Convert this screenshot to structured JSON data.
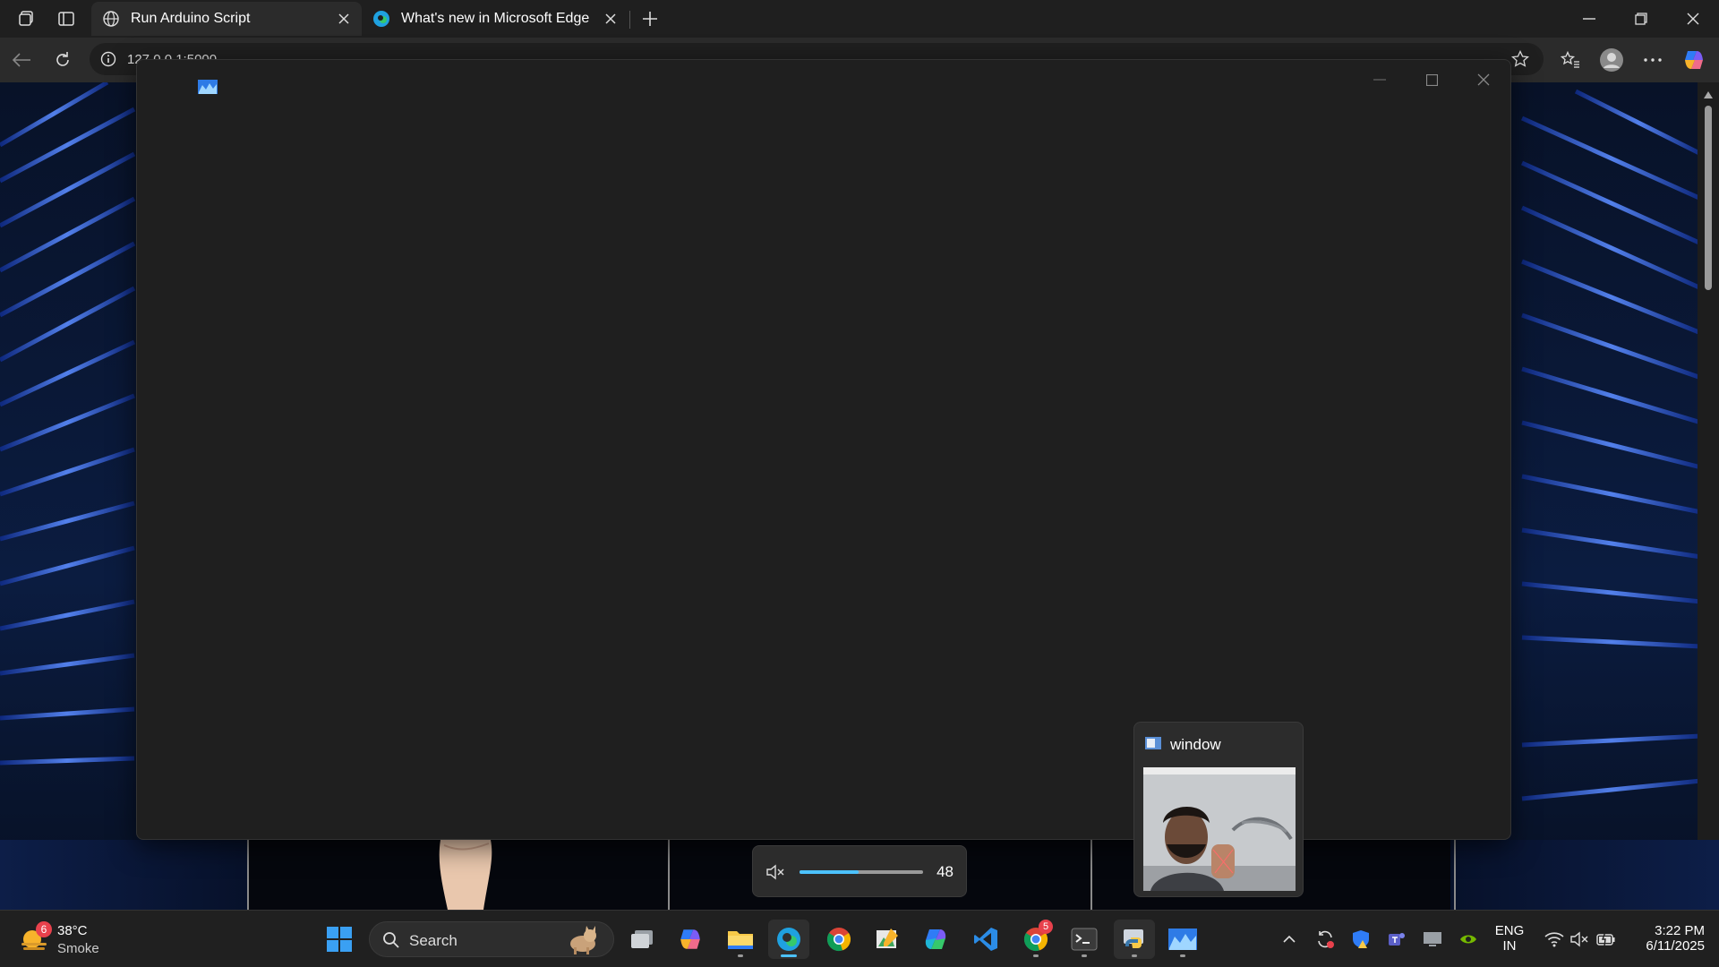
{
  "browser": {
    "tabs": [
      {
        "label": "Run Arduino Script",
        "active": true
      },
      {
        "label": "What's new in Microsoft Edge",
        "active": false
      }
    ],
    "address": "127.0.0.1:5000"
  },
  "volume_flyout": {
    "level": 48,
    "level_label": "48",
    "muted": true
  },
  "thumbnail": {
    "title": "window"
  },
  "taskbar": {
    "weather": {
      "temp": "38°C",
      "condition": "Smoke",
      "badge": "6"
    },
    "search_label": "Search",
    "chrome_badge": "5",
    "language": {
      "line1": "ENG",
      "line2": "IN"
    },
    "clock": {
      "time": "3:22 PM",
      "date": "6/11/2025"
    }
  },
  "colors": {
    "accent": "#4cc2ff",
    "window_bg": "#1f1f1f",
    "taskbar_bg": "#202020"
  }
}
